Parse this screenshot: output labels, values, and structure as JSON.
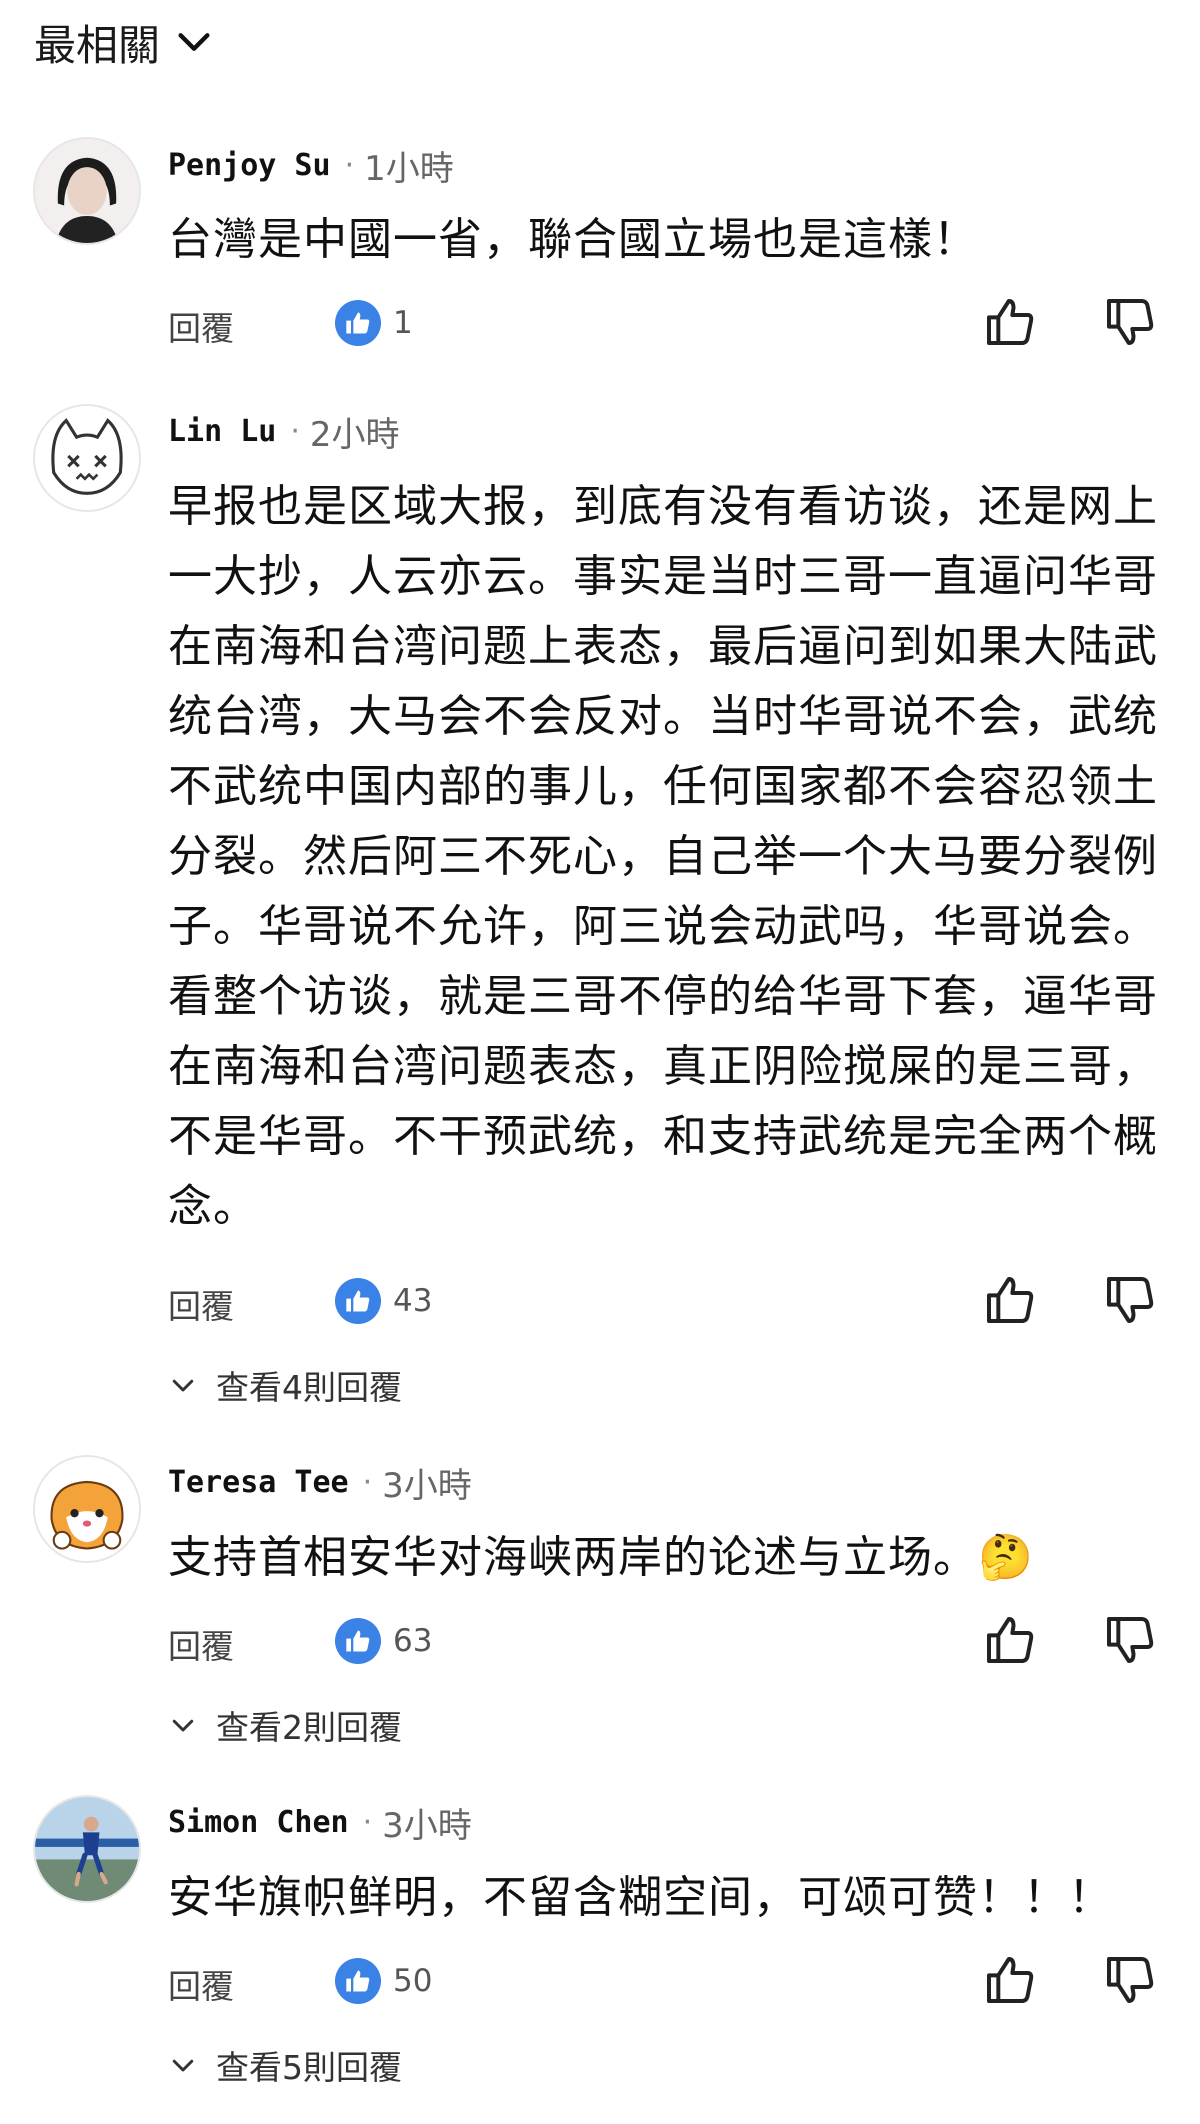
{
  "sort": {
    "label": "最相關"
  },
  "comments": [
    {
      "author": "Penjoy Su",
      "time": "1小時",
      "text": "台灣是中國一省，聯合國立場也是這樣！",
      "reply_label": "回覆",
      "likes": "1"
    },
    {
      "author": "Lin Lu",
      "time": "2小時",
      "text": "早报也是区域大报，到底有没有看访谈，还是网上一大抄，人云亦云。事实是当时三哥一直逼问华哥在南海和台湾问题上表态，最后逼问到如果大陆武统台湾，大马会不会反对。当时华哥说不会，武统不武统中国内部的事儿，任何国家都不会容忍领土分裂。然后阿三不死心，自己举一个大马要分裂例子。华哥说不允许，阿三说会动武吗，华哥说会。看整个访谈，就是三哥不停的给华哥下套，逼华哥在南海和台湾问题表态，真正阴险搅屎的是三哥，不是华哥。不干预武统，和支持武统是完全两个概念。",
      "reply_label": "回覆",
      "likes": "43",
      "view_replies": "查看4則回覆"
    },
    {
      "author": "Teresa Tee",
      "time": "3小時",
      "text": "支持首相安华对海峡两岸的论述与立场。🤔",
      "reply_label": "回覆",
      "likes": "63",
      "view_replies": "查看2則回覆"
    },
    {
      "author": "Simon Chen",
      "time": "3小時",
      "text": "安华旗帜鲜明，不留含糊空间，可颂可赞！！！",
      "reply_label": "回覆",
      "likes": "50",
      "view_replies": "查看5則回覆"
    }
  ],
  "icons": {
    "like_badge_color": "#3b82e6",
    "like_badge": "thumbs-up-icon",
    "like_button": "thumbs-up-outline-icon",
    "dislike_button": "thumbs-down-outline-icon",
    "expand": "chevron-down-icon"
  }
}
